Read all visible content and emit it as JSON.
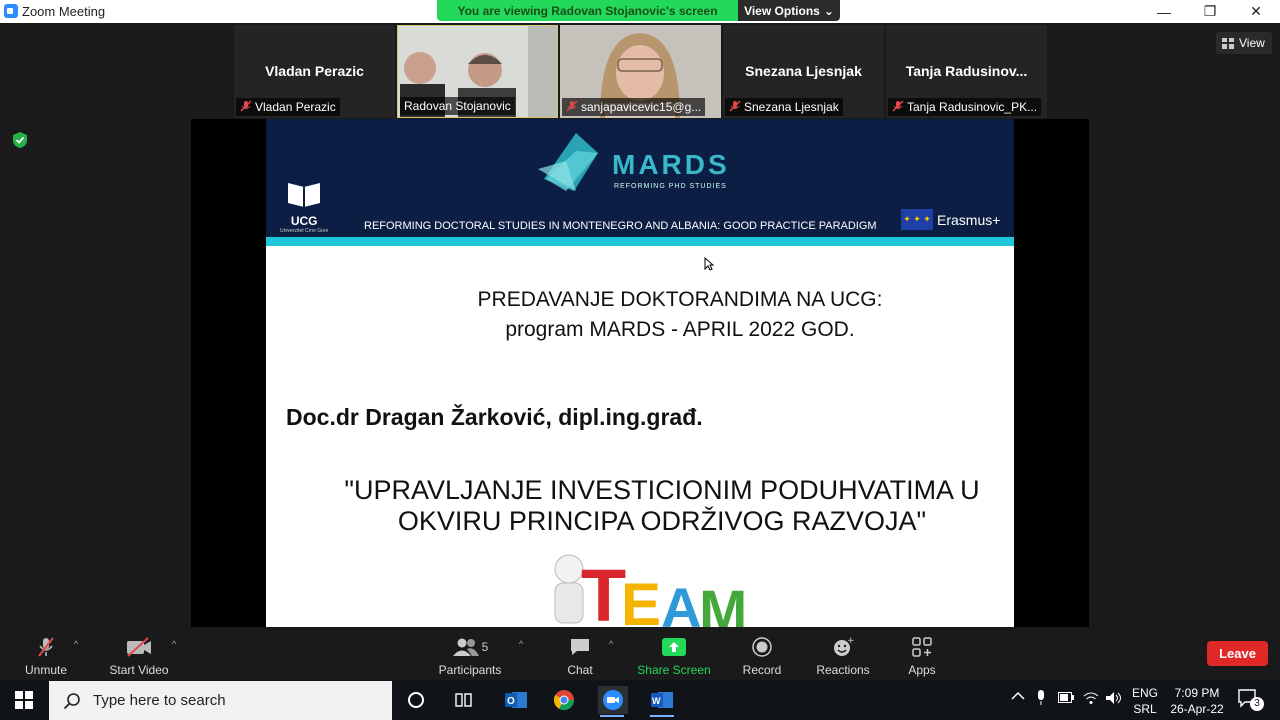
{
  "window": {
    "title": "Zoom Meeting",
    "minimize": "—",
    "restore": "❐",
    "close": "✕"
  },
  "banner": {
    "viewing": "You are viewing Radovan Stojanovic's screen",
    "options": "View Options",
    "options_caret": "⌄"
  },
  "view_button": {
    "label": "View"
  },
  "participants_strip": [
    {
      "big_name": "Vladan Perazic",
      "label": "Vladan Perazic",
      "muted": true,
      "video": false
    },
    {
      "big_name": "",
      "label": "Radovan Stojanovic",
      "muted": false,
      "video": true
    },
    {
      "big_name": "",
      "label": "sanjapavicevic15@g...",
      "muted": true,
      "video": true
    },
    {
      "big_name": "Snezana Ljesnjak",
      "label": "Snezana Ljesnjak",
      "muted": true,
      "video": false
    },
    {
      "big_name": "Tanja  Radusinov...",
      "label": "Tanja Radusinovic_PK...",
      "muted": true,
      "video": false
    }
  ],
  "slide": {
    "logo_text": "MARDS",
    "logo_sub": "REFORMING PHD STUDIES",
    "ucg": "UCG",
    "ucg_sub": "Univerzitet Crne Gore",
    "header_text": "REFORMING DOCTORAL STUDIES IN MONTENEGRO AND ALBANIA: GOOD PRACTICE PARADIGM",
    "erasmus": "Erasmus+",
    "line1": "PREDAVANJE DOKTORANDIMA NA UCG:",
    "line2": "program MARDS - APRIL 2022 GOD.",
    "author": "Doc.dr Dragan Žarković, dipl.ing.građ.",
    "quote1": "\"UPRAVLJANJE INVESTICIONIM PODUHVATIMA U",
    "quote2": "OKVIRU PRINCIPA ODRŽIVOG RAZVOJA\"",
    "team": [
      "T",
      "E",
      "A",
      "M"
    ]
  },
  "toolbar": {
    "unmute": "Unmute",
    "start_video": "Start Video",
    "participants": "Participants",
    "participants_count": "5",
    "chat": "Chat",
    "share_screen": "Share Screen",
    "record": "Record",
    "reactions": "Reactions",
    "apps": "Apps",
    "leave": "Leave",
    "caret": "^"
  },
  "taskbar": {
    "search_placeholder": "Type here to search",
    "lang1": "ENG",
    "lang2": "SRL",
    "time": "7:09 PM",
    "date": "26-Apr-22",
    "notifications": "3"
  },
  "colors": {
    "zoom_green": "#23d959",
    "leave_red": "#e02828",
    "slide_header": "#0c1e44",
    "slide_cyan": "#1ec6d9"
  }
}
